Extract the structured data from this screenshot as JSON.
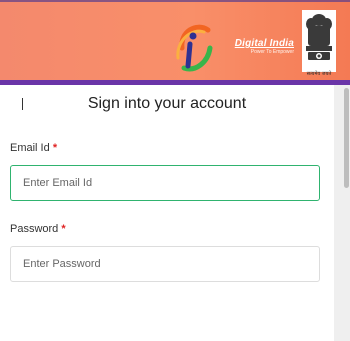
{
  "header": {
    "brand_title": "Digital India",
    "brand_tagline": "Power To Empower",
    "emblem_caption": "सत्यमेव जयते",
    "colors": {
      "gradient_start": "#f4896d",
      "gradient_end": "#f47a54",
      "accent_bar": "#6a35a8"
    },
    "logo_icon": "digital-india-logo-icon",
    "emblem_icon": "national-emblem-icon"
  },
  "form": {
    "title": "Sign into your account",
    "email": {
      "label": "Email Id",
      "required_mark": "*",
      "placeholder": "Enter Email Id",
      "value": "",
      "focused": true
    },
    "password": {
      "label": "Password",
      "required_mark": "*",
      "placeholder": "Enter Password",
      "value": ""
    },
    "colors": {
      "focus_border": "#2fb36f",
      "required": "#e02424"
    }
  }
}
